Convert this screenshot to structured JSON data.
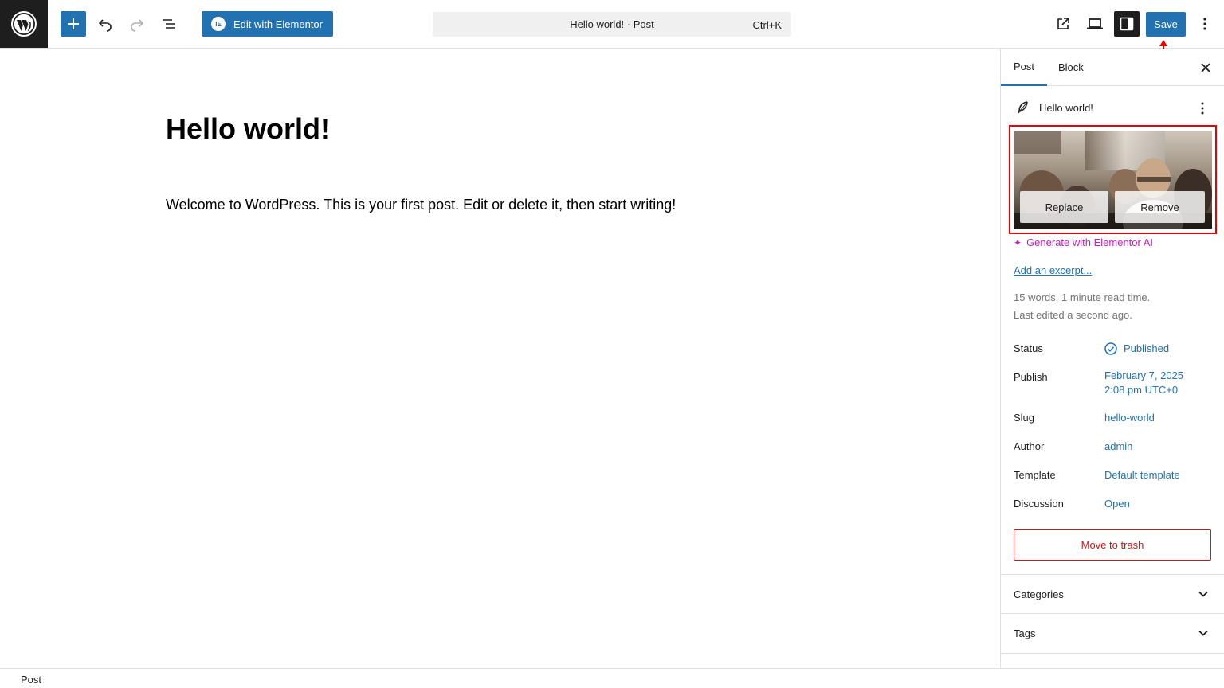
{
  "toolbar": {
    "edit_elementor_label": "Edit with Elementor",
    "elementor_badge": "IE",
    "command_title": "Hello world! · Post",
    "command_shortcut": "Ctrl+K",
    "save_label": "Save"
  },
  "editor": {
    "title": "Hello world!",
    "body": "Welcome to WordPress. This is your first post. Edit or delete it, then start writing!"
  },
  "sidebar": {
    "tabs": [
      "Post",
      "Block"
    ],
    "doc_title": "Hello world!",
    "featured_image": {
      "replace_label": "Replace",
      "remove_label": "Remove"
    },
    "generate_ai_label": "Generate with Elementor AI",
    "add_excerpt_label": "Add an excerpt...",
    "word_count": "15 words, 1 minute read time.",
    "last_edited": "Last edited a second ago.",
    "properties": {
      "status": {
        "label": "Status",
        "value": "Published"
      },
      "publish": {
        "label": "Publish",
        "value_line1": "February 7, 2025",
        "value_line2": "2:08 pm UTC+0"
      },
      "slug": {
        "label": "Slug",
        "value": "hello-world"
      },
      "author": {
        "label": "Author",
        "value": "admin"
      },
      "template": {
        "label": "Template",
        "value": "Default template"
      },
      "discussion": {
        "label": "Discussion",
        "value": "Open"
      }
    },
    "trash_label": "Move to trash",
    "panels": [
      "Categories",
      "Tags"
    ]
  },
  "footer": {
    "breadcrumb": "Post"
  },
  "colors": {
    "accent": "#2271b1",
    "ai_magenta": "#c21fbf",
    "danger": "#cc1818",
    "highlight": "#ee0000"
  }
}
